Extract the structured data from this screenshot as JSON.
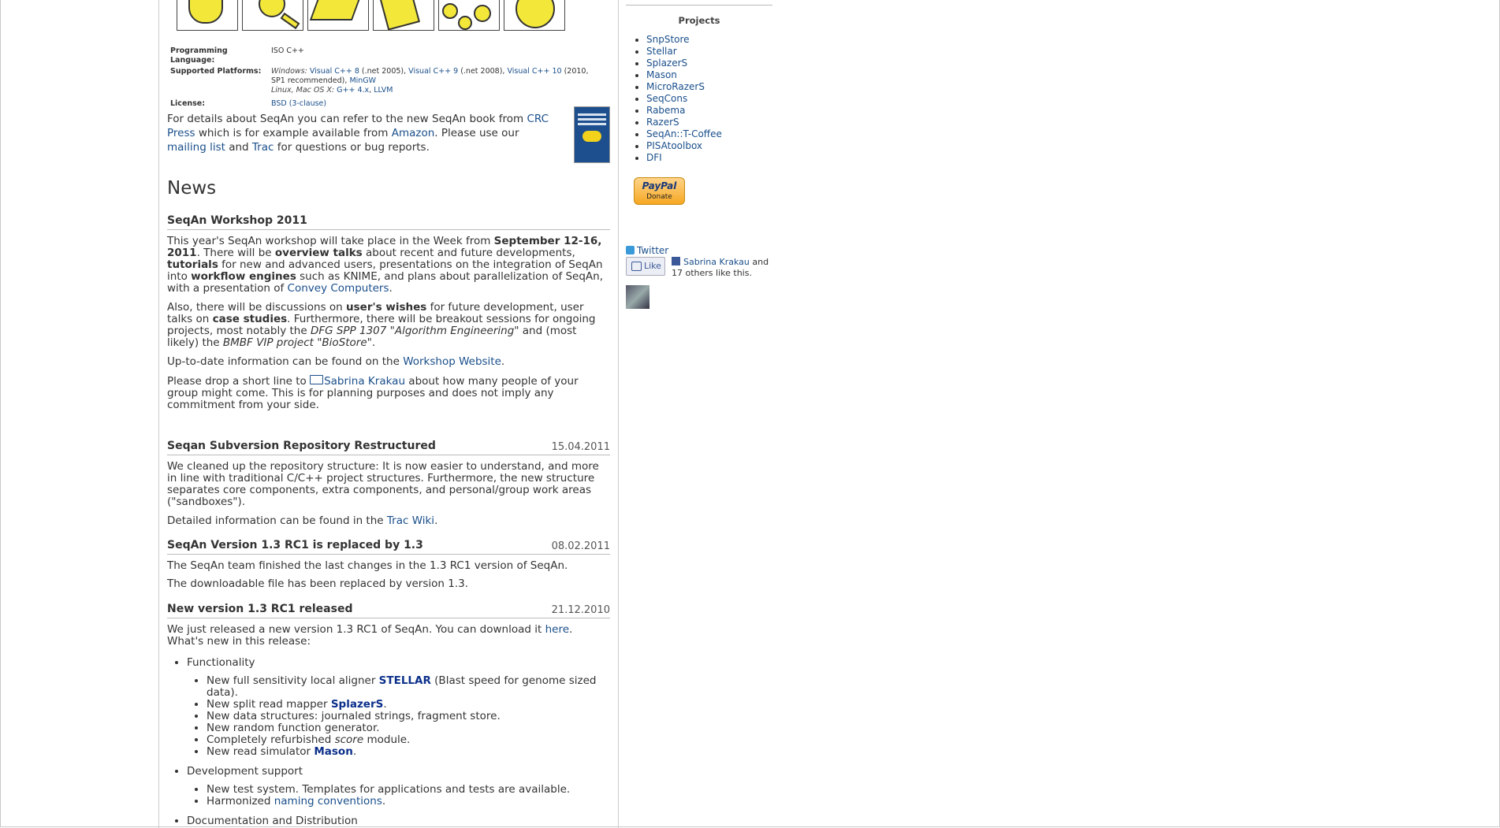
{
  "info": {
    "lang_label": "Programming Language:",
    "lang_value": "ISO C++",
    "platforms_label": "Supported Platforms:",
    "win_label": "Windows:",
    "vc8": "Visual C++ 8",
    "vc8_note": "(.net 2005),",
    "vc9": "Visual C++ 9",
    "vc9_note": "(.net 2008),",
    "vc10": "Visual C++ 10",
    "vc10_note": "(2010, SP1 recommended),",
    "mingw": "MinGW",
    "unix_label": "Linux, Mac OS X:",
    "gcc": "G++ 4.x",
    "llvm": "LLVM",
    "license_label": "License:",
    "license_value": "BSD (3-clause)"
  },
  "details": {
    "t1": "For details about SeqAn you can refer to the new SeqAn book from ",
    "crc": "CRC Press",
    "t2": " which is for example available from ",
    "amazon": "Amazon",
    "t3": ". Please use our ",
    "mailing": "mailing list",
    "t4": " and ",
    "trac": "Trac",
    "t5": " for questions or bug reports."
  },
  "news_title": "News",
  "workshop": {
    "title": "SeqAn Workshop 2011",
    "p1a": "This year's SeqAn workshop will take place in the Week from ",
    "p1b": "September 12-16, 2011",
    "p1c": ". There will be ",
    "p1d": "overview talks",
    "p1e": " about recent and future developments, ",
    "p1f": "tutorials",
    "p1g": " for new and advanced users, presentations on the integration of SeqAn into ",
    "p1h": "workflow engines",
    "p1i": " such as KNIME, and plans about parallelization of SeqAn, with a presentation of ",
    "p1j": "Convey Computers",
    "p1k": ".",
    "p2a": "Also, there will be discussions on ",
    "p2b": "user's wishes",
    "p2c": " for future development, user talks on ",
    "p2d": "case studies",
    "p2e": ". Furthermore, there will be breakout sessions for ongoing projects, most notably the ",
    "p2f": "DFG SPP 1307 \"Algorithm Engineering\"",
    "p2g": " and (most likely) the ",
    "p2h": "BMBF VIP project \"BioStore\"",
    "p2i": ".",
    "p3a": "Up-to-date information can be found on the ",
    "p3b": "Workshop Website",
    "p3c": ".",
    "p4a": "Please drop a short line to ",
    "p4b": "Sabrina Krakau",
    "p4c": " about how many people of your group might come. This is for planning purposes and does not imply any commitment from your side."
  },
  "svn": {
    "title": "Seqan Subversion Repository Restructured",
    "date": "15.04.2011",
    "p1": "We cleaned up the repository structure: It is now easier to understand, and more in line with traditional C/C++ project structures. Furthermore, the new structure separates core components, extra components, and personal/group work areas (\"sandboxes\").",
    "p2a": "Detailed information can be found in the ",
    "p2b": "Trac Wiki",
    "p2c": "."
  },
  "v13": {
    "title": "SeqAn Version 1.3 RC1 is replaced by 1.3",
    "date": "08.02.2011",
    "p1": "The SeqAn team finished the last changes in the 1.3 RC1 version of SeqAn.",
    "p2": "The downloadable file has been replaced by version 1.3."
  },
  "rc1": {
    "title": "New version 1.3 RC1 released",
    "date": "21.12.2010",
    "p1a": "We just released a new version 1.3 RC1 of SeqAn. You can download it ",
    "p1b": "here",
    "p1c": ". What's new in this release:",
    "functionality": "Functionality",
    "f1a": "New full sensitivity local aligner ",
    "f1b": "STELLAR",
    "f1c": " (Blast speed for genome sized data).",
    "f2a": "New split read mapper ",
    "f2b": "SplazerS",
    "f2c": ".",
    "f3": "New data structures: journaled strings, fragment store.",
    "f4": "New random function generator.",
    "f5a": "Completely refurbished ",
    "f5b": "score",
    "f5c": " module.",
    "f6a": "New read simulator ",
    "f6b": "Mason",
    "f6c": ".",
    "devsupport": "Development support",
    "d1": "New test system. Templates for applications and tests are available.",
    "d2a": "Harmonized ",
    "d2b": "naming conventions",
    "d2c": ".",
    "docdist": "Documentation and Distribution"
  },
  "sidebar": {
    "projects_title": "Projects",
    "projects": [
      "SnpStore",
      "Stellar",
      "SplazerS",
      "Mason",
      "MicroRazerS",
      "SeqCons",
      "Rabema",
      "RazerS",
      "SeqAn::T-Coffee",
      "PISAtoolbox",
      "DFI"
    ],
    "paypal": "PayPal",
    "donate": "Donate",
    "twitter": "Twitter",
    "like": "Like",
    "fb_name": "Sabrina Krakau",
    "fb_rest": " and 17 others like this."
  },
  "colors": {
    "link": "#1a4f8b",
    "highlight": "#0b2f8a",
    "icon_yellow": "#f3e83a"
  },
  "icons": [
    "book-icon",
    "magnifier-icon",
    "ruler-icon",
    "box-icon",
    "network-icon",
    "circle-icon",
    "twitter-icon",
    "facebook-icon",
    "email-icon"
  ]
}
